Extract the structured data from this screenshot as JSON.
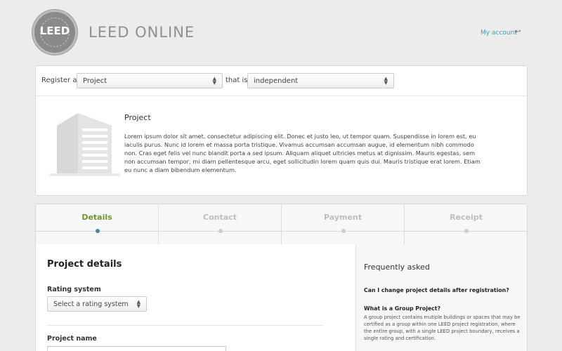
{
  "header": {
    "logo_text": "LEED",
    "app_title": "LEED ONLINE",
    "account_link": "My account",
    "account_icon": "reply-arrow-icon"
  },
  "register": {
    "prefix_label": "Register a",
    "type_select": "Project",
    "middle_label": "that is",
    "status_select": "independent",
    "project_title": "Project",
    "project_description": "Lorem ipsum dolor sit amet, consectetur adipiscing elit. Donec et justo leo, ut tempor quam. Suspendisse in lorem est, eu iaculis purus. Nunc id lorem et massa porta tristique. Vivamus accumsan accumsan augue, id elementum nibh commodo non. Cras eget felis vel nunc blandit porta a sed ipsum. Aliquam aliquet ultricies metus at dignissim. Mauris egestas, sem non accumsan tempor, mi diam pellentesque arcu, eget sollicitudin lorem quam quis dui. Mauris tristique erat lorem. Etiam eu nunc a diam bibendum elementum.",
    "image_icon": "building-icon"
  },
  "steps": [
    {
      "label": "Details",
      "active": true
    },
    {
      "label": "Contact",
      "active": false
    },
    {
      "label": "Payment",
      "active": false
    },
    {
      "label": "Receipt",
      "active": false
    }
  ],
  "form": {
    "section_title": "Project details",
    "rating_label": "Rating system",
    "rating_placeholder": "Select a rating system",
    "name_label": "Project name",
    "name_value": ""
  },
  "faq": {
    "title": "Frequently asked",
    "q1": "Can I change project details after registration?",
    "q2": "What is a Group Project?",
    "a2": "A group project contains mutiple buildings or spaces that may be certified as a group within one LEED project registration, where the entire group, with a single LEED project boundary, receives a single rating and certification."
  },
  "colors": {
    "accent_link": "#3b9bc7",
    "active_step": "#6b9a2b",
    "active_dot": "#4a86a8"
  }
}
